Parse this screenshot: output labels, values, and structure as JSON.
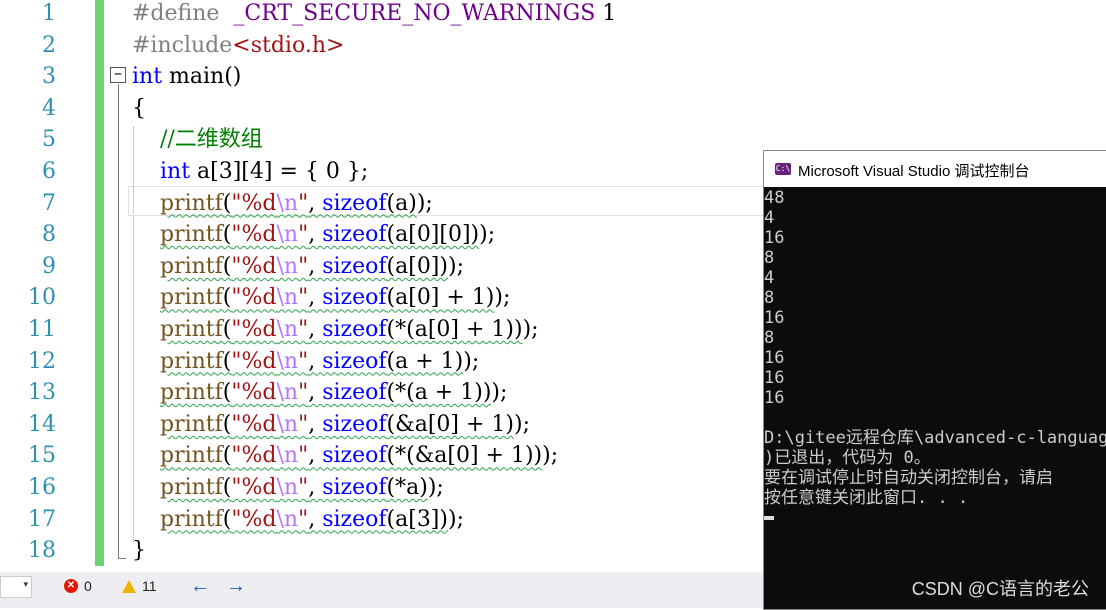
{
  "editor": {
    "line_numbers": [
      "1",
      "2",
      "3",
      "4",
      "5",
      "6",
      "7",
      "8",
      "9",
      "10",
      "11",
      "12",
      "13",
      "14",
      "15",
      "16",
      "17",
      "18"
    ],
    "lines": [
      [
        {
          "t": "#define  ",
          "c": "pp"
        },
        {
          "t": "_CRT_SECURE_NO_WARNINGS",
          "c": "mac"
        },
        {
          "t": " 1",
          "c": "num"
        }
      ],
      [
        {
          "t": "#include",
          "c": "pp"
        },
        {
          "t": "<stdio.h>",
          "c": "inc"
        }
      ],
      [
        {
          "t": "int",
          "c": "kw"
        },
        {
          "t": " main()",
          "c": ""
        }
      ],
      [
        {
          "t": "{",
          "c": ""
        }
      ],
      [
        {
          "t": "    //二维数组",
          "c": "cmt"
        }
      ],
      [
        {
          "t": "    ",
          "c": ""
        },
        {
          "t": "int",
          "c": "kw"
        },
        {
          "t": " a[3][4] = { 0 };",
          "c": ""
        }
      ],
      [
        {
          "t": "    ",
          "c": ""
        },
        {
          "t": "printf",
          "c": "fn sq"
        },
        {
          "t": "(",
          "c": "sq"
        },
        {
          "t": "\"%d",
          "c": "str sq"
        },
        {
          "t": "\\n",
          "c": "esc sq"
        },
        {
          "t": "\"",
          "c": "str sq"
        },
        {
          "t": ", ",
          "c": "sq"
        },
        {
          "t": "sizeof",
          "c": "kw sq"
        },
        {
          "t": "(a)",
          "c": "sq"
        },
        {
          "t": ");",
          "c": ""
        }
      ],
      [
        {
          "t": "    ",
          "c": ""
        },
        {
          "t": "printf",
          "c": "fn sq"
        },
        {
          "t": "(",
          "c": "sq"
        },
        {
          "t": "\"%d",
          "c": "str sq"
        },
        {
          "t": "\\n",
          "c": "esc sq"
        },
        {
          "t": "\"",
          "c": "str sq"
        },
        {
          "t": ", ",
          "c": "sq"
        },
        {
          "t": "sizeof",
          "c": "kw sq"
        },
        {
          "t": "(a[0][0])",
          "c": "sq"
        },
        {
          "t": ");",
          "c": ""
        }
      ],
      [
        {
          "t": "    ",
          "c": ""
        },
        {
          "t": "printf",
          "c": "fn sq"
        },
        {
          "t": "(",
          "c": "sq"
        },
        {
          "t": "\"%d",
          "c": "str sq"
        },
        {
          "t": "\\n",
          "c": "esc sq"
        },
        {
          "t": "\"",
          "c": "str sq"
        },
        {
          "t": ", ",
          "c": "sq"
        },
        {
          "t": "sizeof",
          "c": "kw sq"
        },
        {
          "t": "(a[0])",
          "c": "sq"
        },
        {
          "t": ");",
          "c": ""
        }
      ],
      [
        {
          "t": "    ",
          "c": ""
        },
        {
          "t": "printf",
          "c": "fn sq"
        },
        {
          "t": "(",
          "c": "sq"
        },
        {
          "t": "\"%d",
          "c": "str sq"
        },
        {
          "t": "\\n",
          "c": "esc sq"
        },
        {
          "t": "\"",
          "c": "str sq"
        },
        {
          "t": ", ",
          "c": "sq"
        },
        {
          "t": "sizeof",
          "c": "kw sq"
        },
        {
          "t": "(a[0] + 1)",
          "c": "sq"
        },
        {
          "t": ");",
          "c": ""
        }
      ],
      [
        {
          "t": "    ",
          "c": ""
        },
        {
          "t": "printf",
          "c": "fn sq"
        },
        {
          "t": "(",
          "c": "sq"
        },
        {
          "t": "\"%d",
          "c": "str sq"
        },
        {
          "t": "\\n",
          "c": "esc sq"
        },
        {
          "t": "\"",
          "c": "str sq"
        },
        {
          "t": ", ",
          "c": "sq"
        },
        {
          "t": "sizeof",
          "c": "kw sq"
        },
        {
          "t": "(*(a[0] + 1))",
          "c": "sq"
        },
        {
          "t": ");",
          "c": ""
        }
      ],
      [
        {
          "t": "    ",
          "c": ""
        },
        {
          "t": "printf",
          "c": "fn sq"
        },
        {
          "t": "(",
          "c": "sq"
        },
        {
          "t": "\"%d",
          "c": "str sq"
        },
        {
          "t": "\\n",
          "c": "esc sq"
        },
        {
          "t": "\"",
          "c": "str sq"
        },
        {
          "t": ", ",
          "c": "sq"
        },
        {
          "t": "sizeof",
          "c": "kw sq"
        },
        {
          "t": "(a + 1)",
          "c": "sq"
        },
        {
          "t": ");",
          "c": ""
        }
      ],
      [
        {
          "t": "    ",
          "c": ""
        },
        {
          "t": "printf",
          "c": "fn sq"
        },
        {
          "t": "(",
          "c": "sq"
        },
        {
          "t": "\"%d",
          "c": "str sq"
        },
        {
          "t": "\\n",
          "c": "esc sq"
        },
        {
          "t": "\"",
          "c": "str sq"
        },
        {
          "t": ", ",
          "c": "sq"
        },
        {
          "t": "sizeof",
          "c": "kw sq"
        },
        {
          "t": "(*(a + 1))",
          "c": "sq"
        },
        {
          "t": ");",
          "c": ""
        }
      ],
      [
        {
          "t": "    ",
          "c": ""
        },
        {
          "t": "printf",
          "c": "fn sq"
        },
        {
          "t": "(",
          "c": "sq"
        },
        {
          "t": "\"%d",
          "c": "str sq"
        },
        {
          "t": "\\n",
          "c": "esc sq"
        },
        {
          "t": "\"",
          "c": "str sq"
        },
        {
          "t": ", ",
          "c": "sq"
        },
        {
          "t": "sizeof",
          "c": "kw sq"
        },
        {
          "t": "(&a[0] + 1)",
          "c": "sq"
        },
        {
          "t": ");",
          "c": ""
        }
      ],
      [
        {
          "t": "    ",
          "c": ""
        },
        {
          "t": "printf",
          "c": "fn sq"
        },
        {
          "t": "(",
          "c": "sq"
        },
        {
          "t": "\"%d",
          "c": "str sq"
        },
        {
          "t": "\\n",
          "c": "esc sq"
        },
        {
          "t": "\"",
          "c": "str sq"
        },
        {
          "t": ", ",
          "c": "sq"
        },
        {
          "t": "sizeof",
          "c": "kw sq"
        },
        {
          "t": "(*(&a[0] + 1))",
          "c": "sq"
        },
        {
          "t": ");",
          "c": ""
        }
      ],
      [
        {
          "t": "    ",
          "c": ""
        },
        {
          "t": "printf",
          "c": "fn sq"
        },
        {
          "t": "(",
          "c": "sq"
        },
        {
          "t": "\"%d",
          "c": "str sq"
        },
        {
          "t": "\\n",
          "c": "esc sq"
        },
        {
          "t": "\"",
          "c": "str sq"
        },
        {
          "t": ", ",
          "c": "sq"
        },
        {
          "t": "sizeof",
          "c": "kw sq"
        },
        {
          "t": "(*a)",
          "c": "sq"
        },
        {
          "t": ");",
          "c": ""
        }
      ],
      [
        {
          "t": "    ",
          "c": ""
        },
        {
          "t": "printf",
          "c": "fn sq"
        },
        {
          "t": "(",
          "c": "sq"
        },
        {
          "t": "\"%d",
          "c": "str sq"
        },
        {
          "t": "\\n",
          "c": "esc sq"
        },
        {
          "t": "\"",
          "c": "str sq"
        },
        {
          "t": ", ",
          "c": "sq"
        },
        {
          "t": "sizeof",
          "c": "kw sq"
        },
        {
          "t": "(a[3])",
          "c": "sq"
        },
        {
          "t": ");",
          "c": ""
        }
      ],
      [
        {
          "t": "}",
          "c": ""
        }
      ]
    ]
  },
  "statusbar": {
    "errors": "0",
    "warnings": "11",
    "back_arrow": "←",
    "forward_arrow": "→"
  },
  "console": {
    "title": "Microsoft Visual Studio 调试控制台",
    "icon_label": "C:\\",
    "output": [
      "48",
      "4",
      "16",
      "8",
      "4",
      "8",
      "16",
      "8",
      "16",
      "16",
      "16",
      "",
      "D:\\gitee远程仓库\\advanced-c-languag",
      ")已退出，代码为 0。",
      "要在调试停止时自动关闭控制台，请启",
      "按任意键关闭此窗口. . ."
    ]
  },
  "watermark": "CSDN @C语言的老公",
  "colors": {
    "gutter_green": "#6fd36f",
    "keyword_blue": "#0000ff",
    "string_red": "#a31515",
    "comment_green": "#008000",
    "function_brown": "#74531f",
    "squiggle_green": "#2ea44f",
    "console_bg": "#0c0c0c"
  }
}
